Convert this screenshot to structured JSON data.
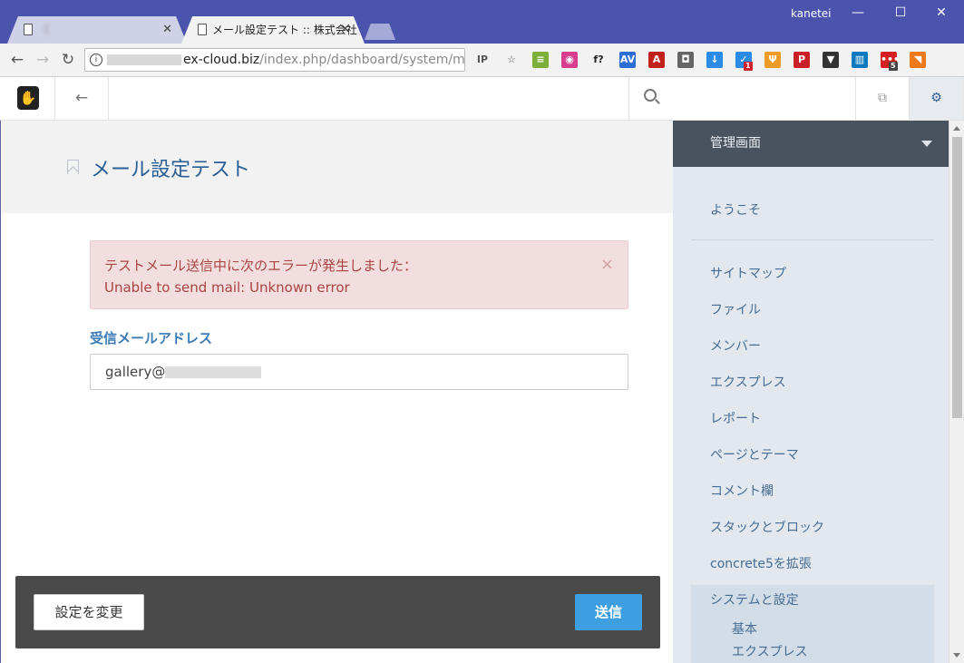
{
  "browser": {
    "tabs": [
      {
        "title": "〈 "
      },
      {
        "title": "メール設定テスト :: 株式会社"
      }
    ],
    "user": "kanetei",
    "window_buttons": {
      "minimize": "—",
      "maximize": "☐",
      "close": "✕"
    },
    "nav": {
      "back": "←",
      "forward": "→",
      "reload": "↻"
    },
    "url": {
      "host": "ex-cloud.biz",
      "path": "/index.php/dashboard/system/mail..."
    },
    "extensions": [
      {
        "name": "ip-icon",
        "label": "IP",
        "color": "#555555"
      },
      {
        "name": "star-icon",
        "label": "☆",
        "color": "#555555"
      },
      {
        "name": "notes-icon",
        "label": "≡",
        "color": "#7cae3a"
      },
      {
        "name": "color-picker-icon",
        "label": "◉",
        "color": "#d83d8d"
      },
      {
        "name": "font-icon",
        "label": "f?",
        "color": "#222222"
      },
      {
        "name": "av-icon",
        "label": "AV",
        "color": "#2b6fd6"
      },
      {
        "name": "pdf-icon",
        "label": "A",
        "color": "#c2201d"
      },
      {
        "name": "camera-icon",
        "label": "◘",
        "color": "#666666"
      },
      {
        "name": "download-icon",
        "label": "↓",
        "color": "#2b8be6"
      },
      {
        "name": "check-icon",
        "label": "✓",
        "color": "#2b8be6",
        "badge": "1"
      },
      {
        "name": "utensils-icon",
        "label": "Ψ",
        "color": "#f09a28"
      },
      {
        "name": "pinterest-icon",
        "label": "P",
        "color": "#cb2027"
      },
      {
        "name": "pocket-icon",
        "label": "▼",
        "color": "#333333"
      },
      {
        "name": "trello-icon",
        "label": "▥",
        "color": "#0a79bf"
      },
      {
        "name": "dots-icon",
        "label": "•••",
        "color": "#d42020",
        "badge": "5"
      },
      {
        "name": "orange-icon",
        "label": "◥",
        "color": "#f07a1a"
      }
    ]
  },
  "page": {
    "title": "メール設定テスト",
    "alert": {
      "line1": "テストメール送信中に次のエラーが発生しました：",
      "line2": "Unable to send mail: Unknown error",
      "close": "×"
    },
    "field_label": "受信メールアドレス",
    "email_value": "gallery@",
    "buttons": {
      "change": "設定を変更",
      "send": "送信"
    }
  },
  "sidebar": {
    "header": "管理画面",
    "welcome": "ようこそ",
    "items": [
      "サイトマップ",
      "ファイル",
      "メンバー",
      "エクスプレス",
      "レポート",
      "ページとテーマ",
      "コメント欄",
      "スタックとブロック",
      "concrete5を拡張",
      "システムと設定"
    ],
    "subitems": [
      "基本",
      "エクスプレス"
    ]
  },
  "header_icons": {
    "back": "←",
    "logo": "✋",
    "intelligent": "⧉",
    "settings": "⚙"
  }
}
